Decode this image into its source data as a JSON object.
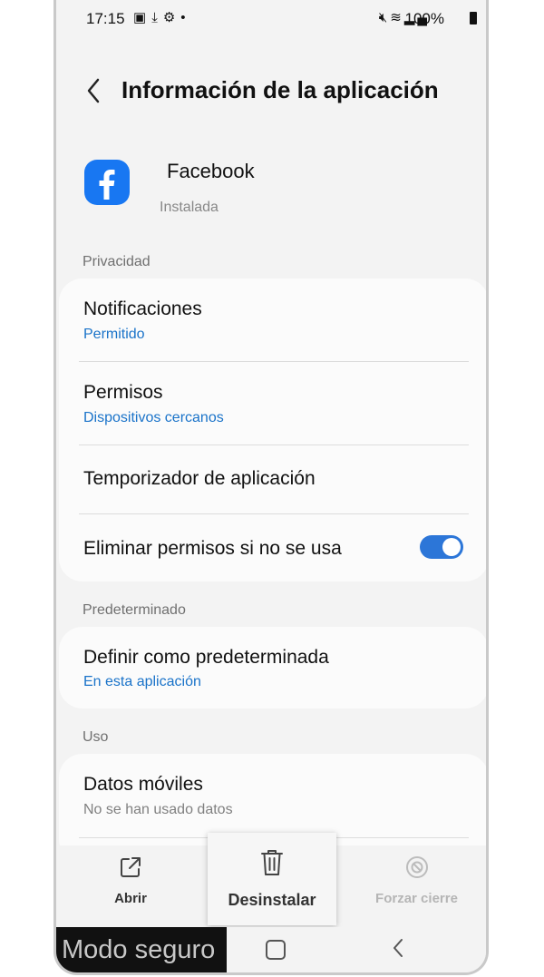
{
  "status_bar": {
    "time": "17:15",
    "battery": "100%",
    "left_icons": [
      "gallery-icon",
      "download-icon",
      "settings-icon",
      "dot-icon"
    ],
    "right_icons": [
      "mute-icon",
      "wifi-icon",
      "signal-icon",
      "battery-icon"
    ]
  },
  "header": {
    "title": "Información de la aplicación"
  },
  "app": {
    "name": "Facebook",
    "status": "Instalada",
    "brand_color": "#1877F2"
  },
  "sections": {
    "privacy": {
      "label": "Privacidad",
      "notifications": {
        "title": "Notificaciones",
        "value": "Permitido"
      },
      "permissions": {
        "title": "Permisos",
        "value": "Dispositivos cercanos"
      },
      "app_timer": {
        "title": "Temporizador de aplicación"
      },
      "remove_permissions": {
        "title": "Eliminar permisos si no se usa",
        "enabled": true
      }
    },
    "defaults": {
      "label": "Predeterminado",
      "set_default": {
        "title": "Definir como predeterminada",
        "value": "En esta aplicación"
      }
    },
    "usage": {
      "label": "Uso",
      "mobile_data": {
        "title": "Datos móviles",
        "value": "No se han usado datos"
      }
    }
  },
  "bottom_actions": {
    "open": "Abrir",
    "uninstall": "Desinstalar",
    "force_stop": "Forzar cierre"
  },
  "navbar": {
    "safe_mode": "Modo seguro"
  },
  "colors": {
    "accent": "#1a73c9",
    "toggle_on": "#2c76d8"
  }
}
